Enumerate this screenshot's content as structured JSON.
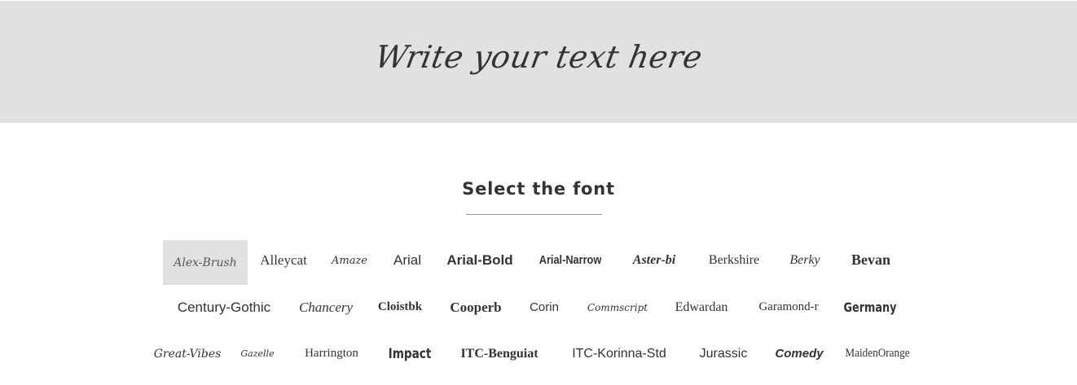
{
  "preview": {
    "text": "Write your text here"
  },
  "section": {
    "title": "Select the font"
  },
  "fonts": {
    "row1": [
      {
        "label": "Alex-Brush",
        "selected": true
      },
      {
        "label": "Alleycat"
      },
      {
        "label": "Amaze"
      },
      {
        "label": "Arial"
      },
      {
        "label": "Arial-Bold"
      },
      {
        "label": "Arial-Narrow"
      },
      {
        "label": "Aster-bi"
      },
      {
        "label": "Berkshire"
      },
      {
        "label": "Berky"
      },
      {
        "label": "Bevan"
      }
    ],
    "row2": [
      {
        "label": "Century-Gothic"
      },
      {
        "label": "Chancery"
      },
      {
        "label": "Cloistbk"
      },
      {
        "label": "Cooperb"
      },
      {
        "label": "Corin"
      },
      {
        "label": "Commscript"
      },
      {
        "label": "Edwardan"
      },
      {
        "label": "Garamond-r"
      },
      {
        "label": "Germany"
      }
    ],
    "row3": [
      {
        "label": "Great-Vibes"
      },
      {
        "label": "Gazelle"
      },
      {
        "label": "Harrington"
      },
      {
        "label": "Impact"
      },
      {
        "label": "ITC-Benguiat"
      },
      {
        "label": "ITC-Korinna-Std"
      },
      {
        "label": "Jurassic"
      },
      {
        "label": "Comedy"
      },
      {
        "label": "MaidenOrange"
      }
    ]
  },
  "colors": {
    "preview_background": "#e1e1e1",
    "selected_background": "#e1e1e1",
    "text": "#333333"
  }
}
